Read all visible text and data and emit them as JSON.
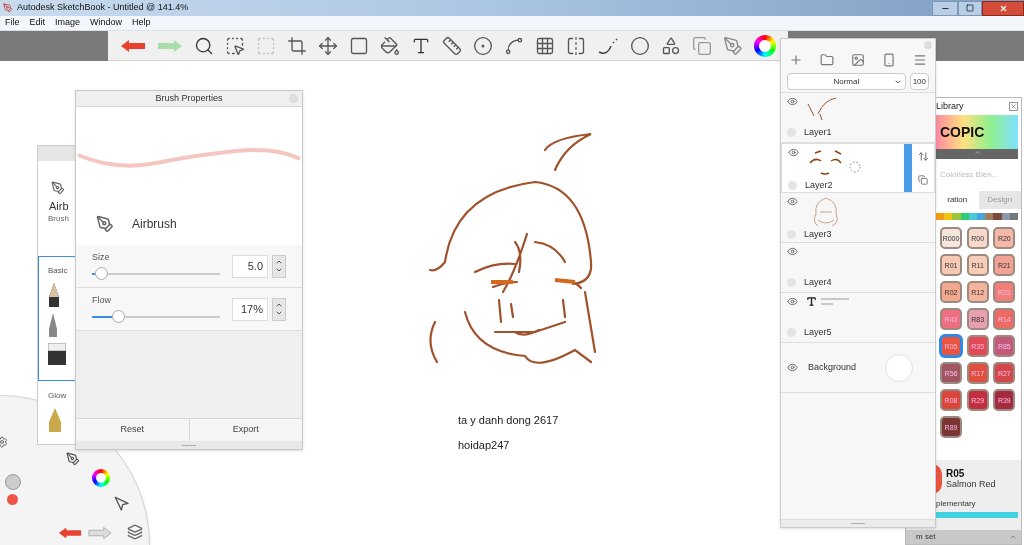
{
  "window": {
    "title": "Autodesk SketchBook - Untitled @ 141.4%"
  },
  "menu": [
    "File",
    "Edit",
    "Image",
    "Window",
    "Help"
  ],
  "brush_library": {
    "name": "Airb",
    "subtitle": "Brush",
    "sets": [
      {
        "label": "Basic",
        "selected": true
      },
      {
        "label": "Glow",
        "selected": false
      }
    ]
  },
  "brush_properties": {
    "title": "Brush Properties",
    "brush_name": "Airbrush",
    "sliders": [
      {
        "label": "Size",
        "level": 0.03,
        "value": "5.0"
      },
      {
        "label": "Flow",
        "level": 0.17,
        "value": "17%"
      }
    ],
    "buttons": [
      "Reset",
      "Export"
    ]
  },
  "canvas": {
    "text_lines": [
      "ta y danh dong 2617",
      "hoidap247"
    ]
  },
  "layers": {
    "blend_mode": "Normal",
    "opacity": "100",
    "items": [
      {
        "name": "Layer1",
        "kind": "neck",
        "selected": false
      },
      {
        "name": "Layer2",
        "kind": "face",
        "selected": true
      },
      {
        "name": "Layer3",
        "kind": "sketch",
        "selected": false
      },
      {
        "name": "Layer4",
        "kind": "empty",
        "selected": false
      },
      {
        "name": "Layer5",
        "kind": "text",
        "selected": false
      },
      {
        "name": "Background",
        "kind": "background",
        "selected": false
      }
    ]
  },
  "copic": {
    "title": "Library",
    "logo": "COPIC",
    "header": "Colorless Blen...",
    "tabs": [
      {
        "label": "ration",
        "selected": true
      },
      {
        "label": "Design",
        "selected": false
      }
    ],
    "swatches": [
      {
        "code": "R000",
        "color": "#f5e6dc",
        "selected": false
      },
      {
        "code": "R00",
        "color": "#f6d9cc",
        "selected": false
      },
      {
        "code": "R20",
        "color": "#f5b8a8",
        "selected": false
      },
      {
        "code": "R01",
        "color": "#f7c9b5",
        "selected": false
      },
      {
        "code": "R11",
        "color": "#f8cdb8",
        "selected": false
      },
      {
        "code": "R21",
        "color": "#f3a095",
        "selected": false
      },
      {
        "code": "R02",
        "color": "#f2a98f",
        "selected": false
      },
      {
        "code": "R12",
        "color": "#f4b39d",
        "selected": false
      },
      {
        "code": "R22",
        "color": "#ef7f78",
        "selected": false
      },
      {
        "code": "R43",
        "color": "#ee6f7f",
        "selected": false
      },
      {
        "code": "R83",
        "color": "#e8a0b0",
        "selected": false
      },
      {
        "code": "R14",
        "color": "#ec6a64",
        "selected": false
      },
      {
        "code": "R05",
        "color": "#e9543f",
        "selected": true
      },
      {
        "code": "R35",
        "color": "#e24a56",
        "selected": false
      },
      {
        "code": "R85",
        "color": "#c45a7a",
        "selected": false
      },
      {
        "code": "R56",
        "color": "#a05660",
        "selected": false
      },
      {
        "code": "R17",
        "color": "#e0503f",
        "selected": false
      },
      {
        "code": "R27",
        "color": "#d2474a",
        "selected": false
      },
      {
        "code": "R08",
        "color": "#d9463a",
        "selected": false
      },
      {
        "code": "R29",
        "color": "#c23040",
        "selected": false
      },
      {
        "code": "R39",
        "color": "#a32a3f",
        "selected": false
      },
      {
        "code": "R89",
        "color": "#7b3535",
        "selected": false
      }
    ],
    "current": {
      "code": "R05",
      "name": "Salmon Red"
    },
    "section": "plementary",
    "footer": "m set"
  }
}
